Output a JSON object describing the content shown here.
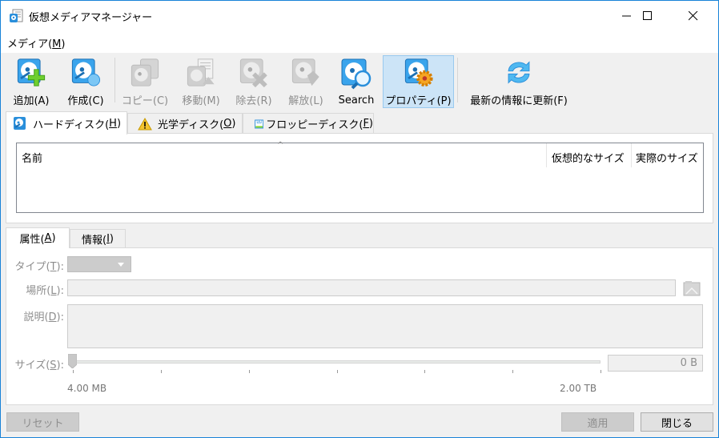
{
  "window": {
    "title": "仮想メディアマネージャー",
    "icon": "virtual-media-manager-icon",
    "controls": {
      "minimize": "minimize-icon",
      "maximize": "maximize-icon",
      "close": "close-icon"
    }
  },
  "menu": {
    "items": [
      {
        "label": "メディア(",
        "accel": "M",
        "suffix": ")"
      }
    ]
  },
  "toolbar": {
    "buttons": [
      {
        "label": "追加(A)",
        "icon": "hard-disk-add-icon",
        "enabled": true
      },
      {
        "label": "作成(C)",
        "icon": "hard-disk-create-icon",
        "enabled": true
      },
      {
        "label": "コピー(C)",
        "icon": "hard-disk-copy-icon",
        "enabled": false
      },
      {
        "label": "移動(M)",
        "icon": "hard-disk-move-icon",
        "enabled": false
      },
      {
        "label": "除去(R)",
        "icon": "hard-disk-remove-icon",
        "enabled": false
      },
      {
        "label": "解放(L)",
        "icon": "hard-disk-release-icon",
        "enabled": false
      },
      {
        "label": "Search",
        "icon": "hard-disk-search-icon",
        "enabled": true
      },
      {
        "label": "プロパティ(P)",
        "icon": "hard-disk-properties-icon",
        "enabled": true,
        "active": true
      },
      {
        "label": "最新の情報に更新(F)",
        "icon": "refresh-icon",
        "enabled": true
      }
    ]
  },
  "media_tabs": [
    {
      "label": "ハードディスク(",
      "accel": "H",
      "suffix": ")",
      "icon": "hard-disk-icon",
      "active": true
    },
    {
      "label": "光学ディスク(",
      "accel": "O",
      "suffix": ")",
      "icon": "warning-icon",
      "active": false
    },
    {
      "label": "フロッピーディスク(",
      "accel": "F",
      "suffix": ")",
      "icon": "floppy-disk-icon",
      "active": false
    }
  ],
  "media_list": {
    "columns": [
      "名前",
      "仮想的なサイズ",
      "実際のサイズ"
    ],
    "sort_indicator": "^",
    "rows": []
  },
  "detail_tabs": [
    {
      "label": "属性(",
      "accel": "A",
      "suffix": ")",
      "active": true
    },
    {
      "label": "情報(",
      "accel": "I",
      "suffix": ")",
      "active": false
    }
  ],
  "attributes": {
    "type_label": {
      "text": "タイプ(",
      "accel": "T",
      "suffix": "):"
    },
    "type_value": "",
    "location_label": {
      "text": "場所(",
      "accel": "L",
      "suffix": "):"
    },
    "location_value": "",
    "description_label": {
      "text": "説明(",
      "accel": "D",
      "suffix": "):"
    },
    "description_value": "",
    "size_label": {
      "text": "サイズ(",
      "accel": "S",
      "suffix": "):"
    },
    "size_min": "4.00 MB",
    "size_max": "2.00 TB",
    "size_slider_fraction": 0,
    "size_value": "0 B"
  },
  "footer": {
    "reset": "リセット",
    "apply": "適用",
    "close": "閉じる"
  }
}
